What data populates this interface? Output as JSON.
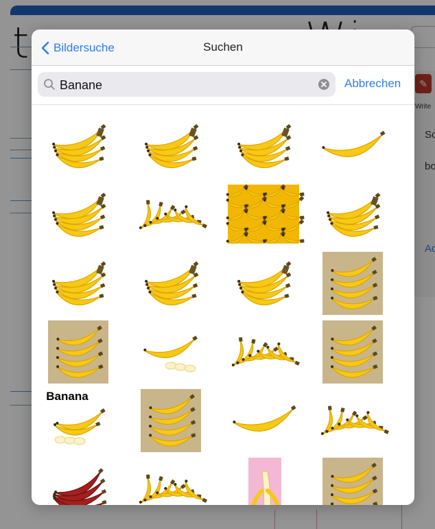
{
  "nav": {
    "back_label": "Bildersuche",
    "title": "Suchen"
  },
  "search": {
    "value": "Banane",
    "cancel_label": "Abbrechen"
  },
  "background_app": {
    "write_label": "Write",
    "side_items": [
      "Sc",
      "bo"
    ],
    "side_link": "Ad"
  },
  "results": [
    {
      "name": "banana-bunch-small",
      "style": "bunch"
    },
    {
      "name": "banana-bunch-flat",
      "style": "bunch"
    },
    {
      "name": "banana-bunch-large",
      "style": "bunch"
    },
    {
      "name": "banana-single-curved",
      "style": "single"
    },
    {
      "name": "banana-bunch-upright",
      "style": "bunch"
    },
    {
      "name": "banana-cluster-small",
      "style": "cluster"
    },
    {
      "name": "banana-pile-pattern",
      "style": "pattern"
    },
    {
      "name": "banana-bunch-right",
      "style": "bunch"
    },
    {
      "name": "banana-bunch-hand",
      "style": "bunch"
    },
    {
      "name": "banana-bunch-wide",
      "style": "bunch"
    },
    {
      "name": "banana-bunch-ripe",
      "style": "bunch"
    },
    {
      "name": "banana-bunch-photo",
      "style": "photo"
    },
    {
      "name": "banana-bunch-portrait-photo",
      "style": "photo"
    },
    {
      "name": "banana-sliced",
      "style": "sliced"
    },
    {
      "name": "banana-cluster-green",
      "style": "cluster"
    },
    {
      "name": "banana-plantation-photo",
      "style": "photo"
    },
    {
      "name": "banana-labeled-sliced",
      "style": "labeled",
      "label": "Banana"
    },
    {
      "name": "banana-faces-photo",
      "style": "photo"
    },
    {
      "name": "banana-single-long",
      "style": "single"
    },
    {
      "name": "banana-cluster-wide",
      "style": "cluster"
    },
    {
      "name": "banana-red-bunch",
      "style": "red"
    },
    {
      "name": "banana-hand-fan",
      "style": "cluster"
    },
    {
      "name": "banana-peeled-pink",
      "style": "peeled"
    },
    {
      "name": "banana-plantain-photo",
      "style": "photo"
    }
  ],
  "colors": {
    "accent": "#2f7bf5",
    "banana_yellow": "#f6c915",
    "banana_dark": "#e0a500",
    "overlay": "rgba(0,0,0,0.42)"
  }
}
